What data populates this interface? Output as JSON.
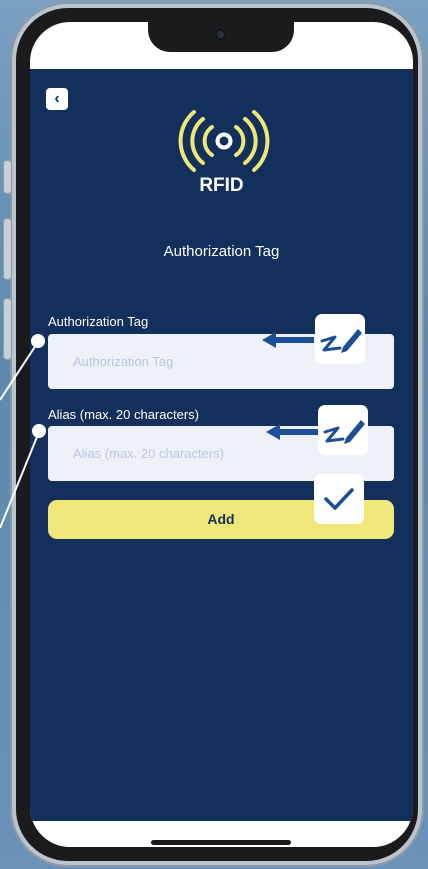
{
  "app": {
    "logo_text": "RFID",
    "page_title": "Authorization Tag"
  },
  "form": {
    "tag_label": "Authorization Tag",
    "tag_placeholder": "Authorization Tag",
    "alias_label": "Alias (max. 20 characters)",
    "alias_placeholder": "Alias (max. 20 characters)",
    "add_label": "Add"
  },
  "icons": {
    "back": "chevron-left-icon",
    "rfid": "rfid-signal-icon",
    "edit": "pen-swipe-icon",
    "confirm": "checkmark-icon",
    "arrow": "arrow-left-icon"
  },
  "colors": {
    "app_background": "#132f5b",
    "accent_yellow": "#efe779",
    "field_background": "#eef2f8",
    "placeholder_text": "#b9c7e4",
    "annotation_blue": "#1c4f96"
  }
}
